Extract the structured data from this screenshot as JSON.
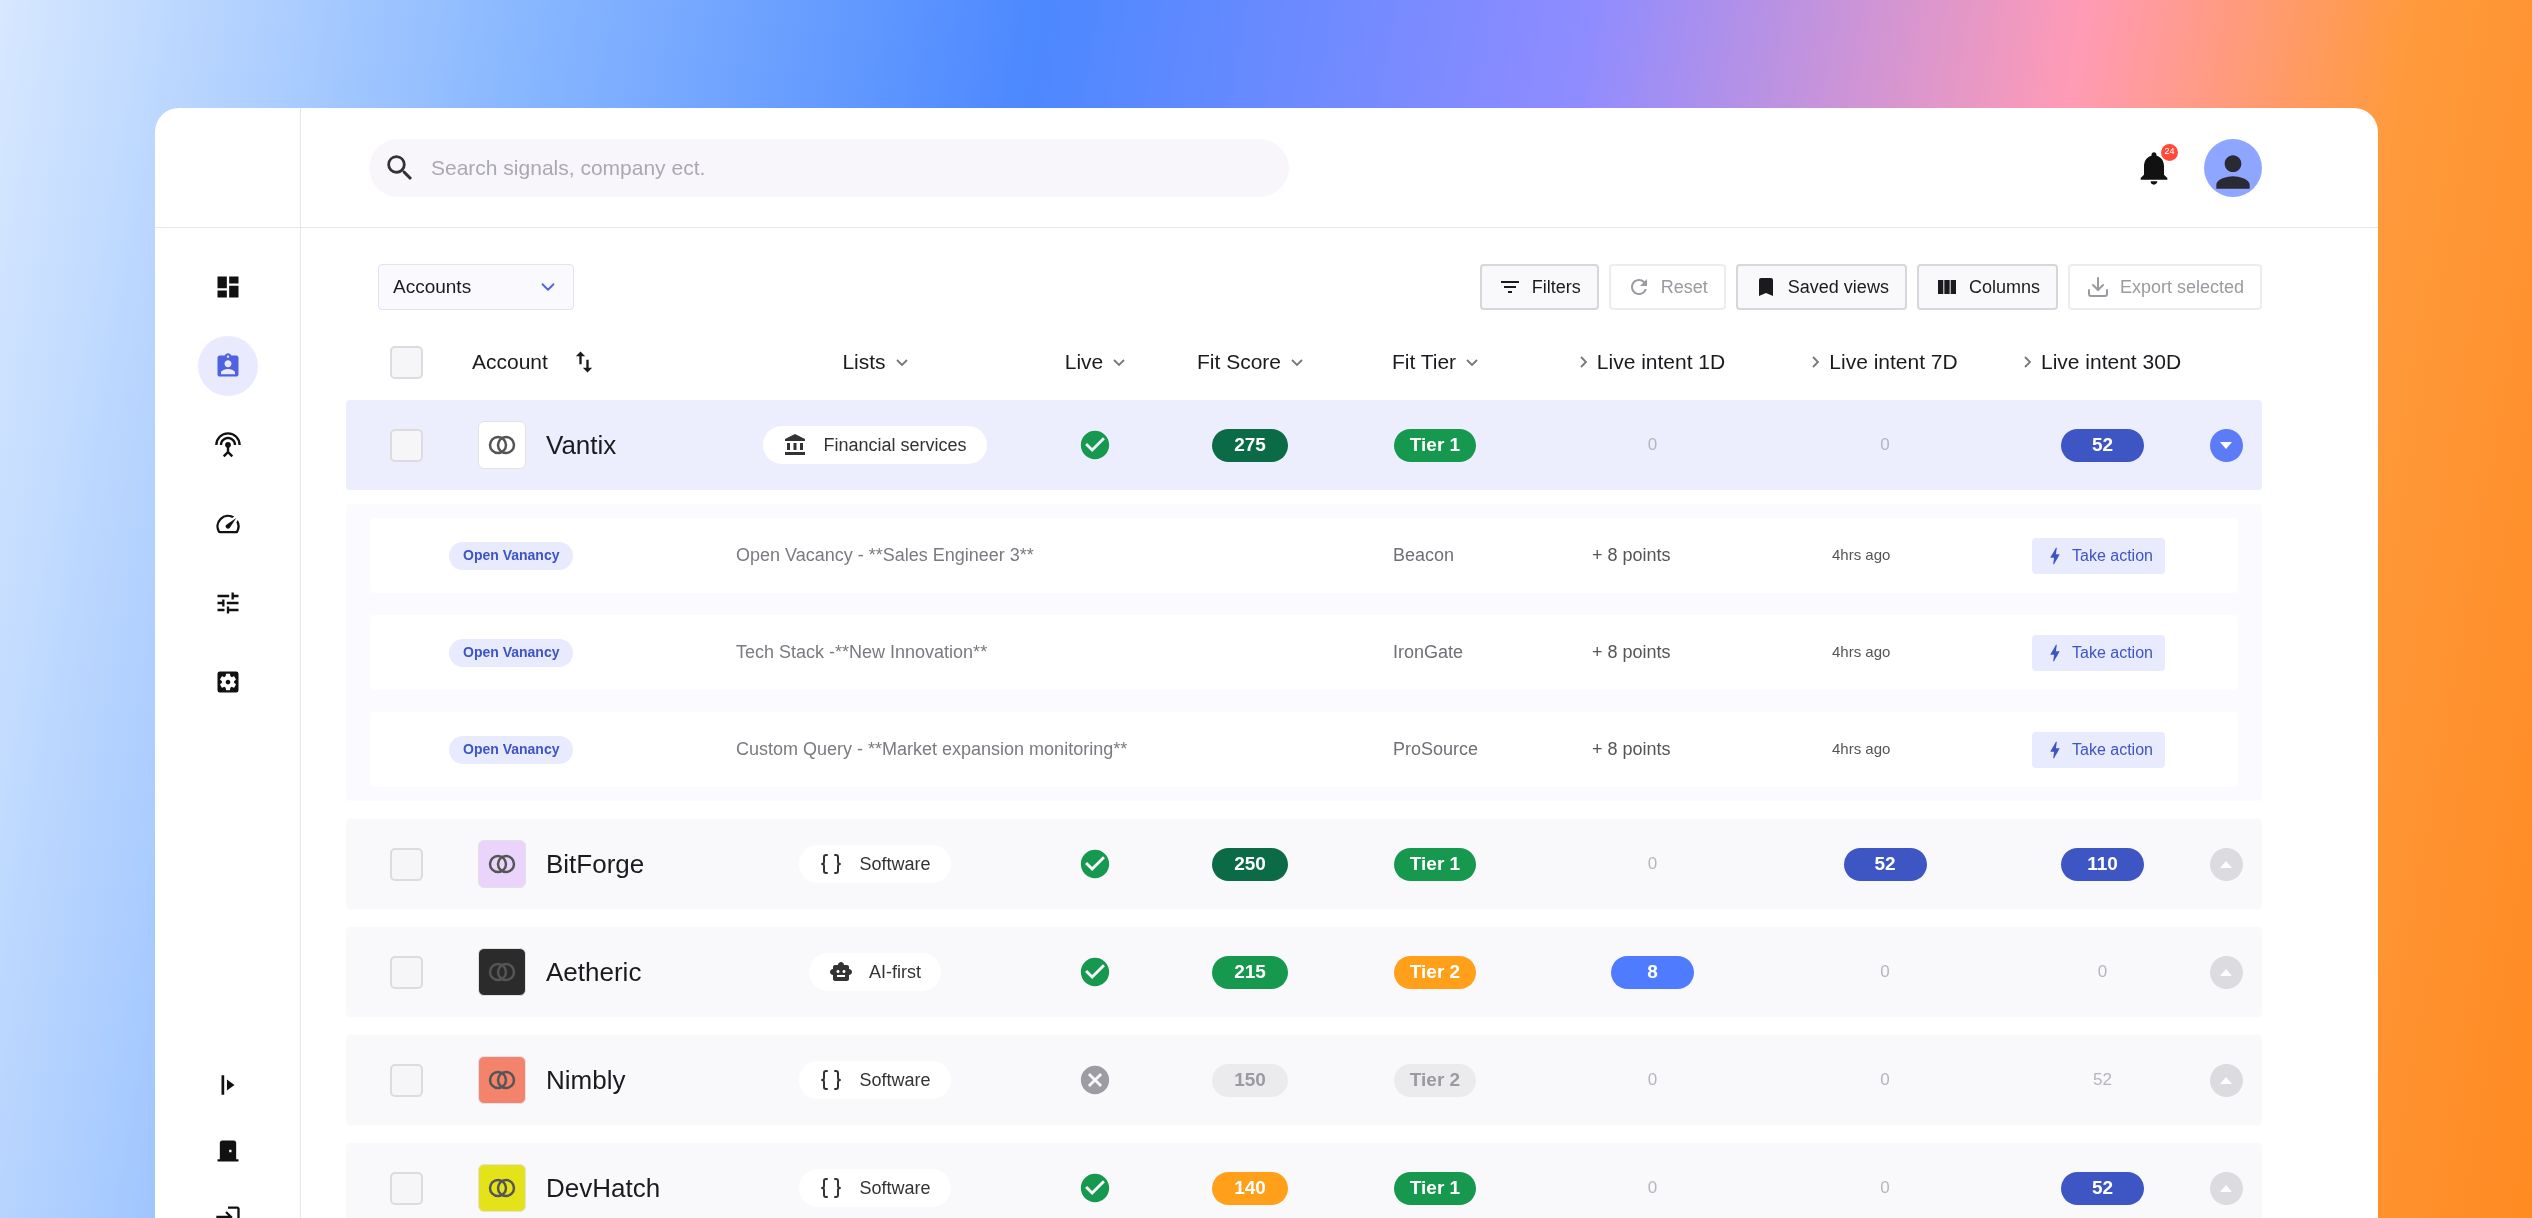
{
  "search": {
    "placeholder": "Search signals, company ect."
  },
  "notifications": {
    "count": "24"
  },
  "sidebar": {
    "items": [
      {
        "selected": false
      },
      {
        "selected": true
      },
      {
        "selected": false
      },
      {
        "selected": false
      },
      {
        "selected": false
      },
      {
        "selected": false
      }
    ],
    "bottom_items": [
      {
        "selected": false
      },
      {
        "selected": false
      },
      {
        "selected": false
      }
    ]
  },
  "toolbar": {
    "view": "Accounts",
    "buttons": [
      {
        "label": "Filters",
        "kind": "filter",
        "disabled": false
      },
      {
        "label": "Reset",
        "kind": "reset",
        "disabled": true
      },
      {
        "label": "Saved views",
        "kind": "bookmark",
        "disabled": false
      },
      {
        "label": "Columns",
        "kind": "columns",
        "disabled": false
      },
      {
        "label": "Export selected",
        "kind": "export",
        "disabled": true
      }
    ]
  },
  "table": {
    "select_all": {
      "checked": false
    },
    "columns": [
      {
        "label": "Account",
        "kind": "sort"
      },
      {
        "label": "Lists",
        "kind": "menu"
      },
      {
        "label": "Live",
        "kind": "menu"
      },
      {
        "label": "Fit Score",
        "kind": "menu"
      },
      {
        "label": "Fit Tier",
        "kind": "menu"
      },
      {
        "label": "Live intent 1D",
        "kind": "expand"
      },
      {
        "label": "Live intent 7D",
        "kind": "expand"
      },
      {
        "label": "Live intent 30D",
        "kind": "expand"
      }
    ],
    "rows": [
      {
        "name": "Vantix",
        "logo": {
          "color": "#ffffff"
        },
        "checked": false,
        "selected": true,
        "expanded": true,
        "list": {
          "label": "Financial services",
          "kind": "bank"
        },
        "live": true,
        "fit_score": {
          "value": "275",
          "color": "#0b6b47"
        },
        "fit_tier": {
          "label": "Tier 1",
          "color": "#16994f"
        },
        "intent_1d": {
          "value": "0"
        },
        "intent_7d": {
          "value": "0"
        },
        "intent_30d": {
          "value": "52",
          "color": "#3d56c4"
        },
        "signals": [
          {
            "tag": "Open Vanancy",
            "text": "Open Vacancy - **Sales Engineer 3**",
            "source": "Beacon",
            "points": "+ 8 points",
            "time": "4hrs ago",
            "action": "Take action"
          },
          {
            "tag": "Open Vanancy",
            "text": "Tech Stack  -**New Innovation**",
            "source": "IronGate",
            "points": "+ 8 points",
            "time": "4hrs ago",
            "action": "Take action"
          },
          {
            "tag": "Open Vanancy",
            "text": "Custom Query - **Market expansion monitoring**",
            "source": "ProSource",
            "points": "+ 8 points",
            "time": "4hrs ago",
            "action": "Take action"
          }
        ]
      },
      {
        "name": "BitForge",
        "logo": {
          "color": "#ead4fb"
        },
        "checked": false,
        "selected": false,
        "expanded": false,
        "list": {
          "label": "Software",
          "kind": "code"
        },
        "live": true,
        "fit_score": {
          "value": "250",
          "color": "#0b6b47"
        },
        "fit_tier": {
          "label": "Tier 1",
          "color": "#16994f"
        },
        "intent_1d": {
          "value": "0"
        },
        "intent_7d": {
          "value": "52",
          "color": "#3d56c4"
        },
        "intent_30d": {
          "value": "110",
          "color": "#3d56c4"
        }
      },
      {
        "name": "Aetheric",
        "logo": {
          "color": "#2b2b2b"
        },
        "checked": false,
        "selected": false,
        "expanded": false,
        "list": {
          "label": "AI-first",
          "kind": "bot"
        },
        "live": true,
        "fit_score": {
          "value": "215",
          "color": "#16994f"
        },
        "fit_tier": {
          "label": "Tier 2",
          "color": "#ff9f1a"
        },
        "intent_1d": {
          "value": "8",
          "color": "#4f7bff"
        },
        "intent_7d": {
          "value": "0"
        },
        "intent_30d": {
          "value": "0"
        }
      },
      {
        "name": "Nimbly",
        "logo": {
          "color": "#f4836b"
        },
        "checked": false,
        "selected": false,
        "expanded": false,
        "list": {
          "label": "Software",
          "kind": "code"
        },
        "live": false,
        "fit_score": {
          "value": "150"
        },
        "fit_tier": {
          "label": "Tier 2"
        },
        "intent_1d": {
          "value": "0"
        },
        "intent_7d": {
          "value": "0"
        },
        "intent_30d": {
          "value": "52"
        }
      },
      {
        "name": "DevHatch",
        "logo": {
          "color": "#e4e31a"
        },
        "checked": false,
        "selected": false,
        "expanded": false,
        "list": {
          "label": "Software",
          "kind": "code"
        },
        "live": true,
        "fit_score": {
          "value": "140",
          "color": "#ff9f1a"
        },
        "fit_tier": {
          "label": "Tier 1",
          "color": "#16994f"
        },
        "intent_1d": {
          "value": "0"
        },
        "intent_7d": {
          "value": "0"
        },
        "intent_30d": {
          "value": "52",
          "color": "#3d56c4"
        }
      }
    ]
  }
}
